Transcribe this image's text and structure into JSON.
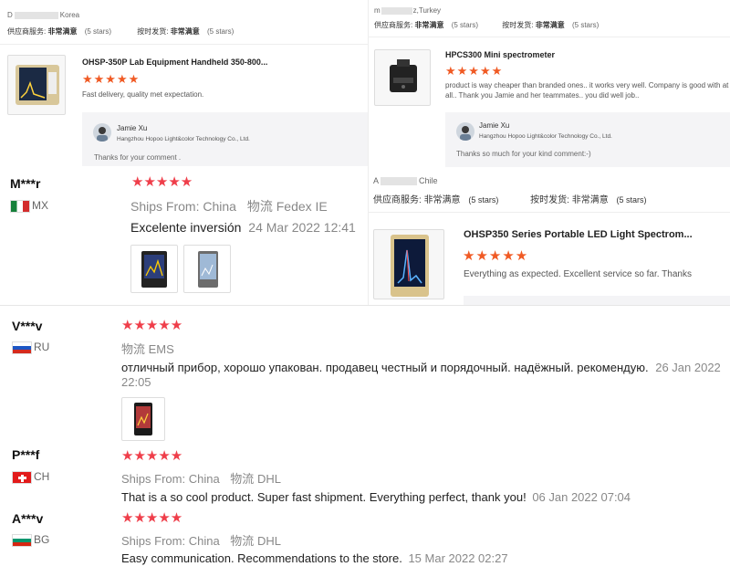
{
  "card1": {
    "buyer_prefix": "D",
    "buyer_country": "Korea",
    "service_label": "供应商服务:",
    "service_value": "非常满意",
    "service_stars": "(5 stars)",
    "ship_label": "按时发货:",
    "ship_value": "非常满意",
    "ship_stars": "(5 stars)",
    "product_title": "OHSP-350P Lab Equipment Handheld 350-800...",
    "stars": "★★★★★",
    "review_text": "Fast delivery, quality met expectation.",
    "reply_name": "Jamie Xu",
    "reply_company": "Hangzhou Hopoo Light&color Technology Co., Ltd.",
    "reply_text": "Thanks for your comment ."
  },
  "card2": {
    "buyer_prefix": "m",
    "buyer_country": "z,Turkey",
    "service_label": "供应商服务:",
    "service_value": "非常满意",
    "service_stars": "(5 stars)",
    "ship_label": "按时发货:",
    "ship_value": "非常满意",
    "ship_stars": "(5 stars)",
    "product_title": "HPCS300 Mini spectrometer",
    "stars": "★★★★★",
    "review_text": "product is way cheaper than branded ones.. it works very well. Company is good with at all.. Thank you Jamie and her teammates.. you did well job..",
    "reply_name": "Jamie Xu",
    "reply_company": "Hangzhou Hopoo Light&color Technology Co., Ltd.",
    "reply_text": "Thanks so much for your kind comment:-)"
  },
  "card3": {
    "buyer_prefix": "A",
    "buyer_country": "Chile",
    "service_label": "供应商服务:",
    "service_value": "非常满意",
    "service_stars": "(5 stars)",
    "ship_label": "按时发货:",
    "ship_value": "非常满意",
    "ship_stars": "(5 stars)",
    "product_title": "OHSP350 Series Portable LED Light Spectrom...",
    "stars": "★★★★★",
    "review_text": "Everything as expected. Excellent service so far. Thanks"
  },
  "review_mx": {
    "name": "M***r",
    "country": "MX",
    "stars": "★★★★★",
    "ships_from_label": "Ships From:",
    "ships_from_value": "China",
    "logistics_label": "物流",
    "logistics_value": "Fedex IE",
    "text": "Excelente inversión",
    "date": "24 Mar 2022 12:41"
  },
  "review_ru": {
    "name": "V***v",
    "country": "RU",
    "stars": "★★★★★",
    "logistics_label": "物流",
    "logistics_value": "EMS",
    "text": "отличный прибор, хорошо упакован. продавец честный и порядочный. надёжный. рекомендую.",
    "date": "26 Jan 2022",
    "time": "22:05"
  },
  "review_ch": {
    "name": "P***f",
    "country": "CH",
    "stars": "★★★★★",
    "ships_from_label": "Ships From:",
    "ships_from_value": "China",
    "logistics_label": "物流",
    "logistics_value": "DHL",
    "text": "That is a so cool product. Super fast shipment. Everything perfect, thank you!",
    "date": "06 Jan 2022 07:04"
  },
  "review_bg": {
    "name": "A***v",
    "country": "BG",
    "stars": "★★★★★",
    "ships_from_label": "Ships From:",
    "ships_from_value": "China",
    "logistics_label": "物流",
    "logistics_value": "DHL",
    "text": "Easy communication. Recommendations to the store.",
    "date": "15 Mar 2022 02:27"
  },
  "colors": {
    "star_orange": "#f05a24",
    "star_red": "#ef3e4a"
  }
}
